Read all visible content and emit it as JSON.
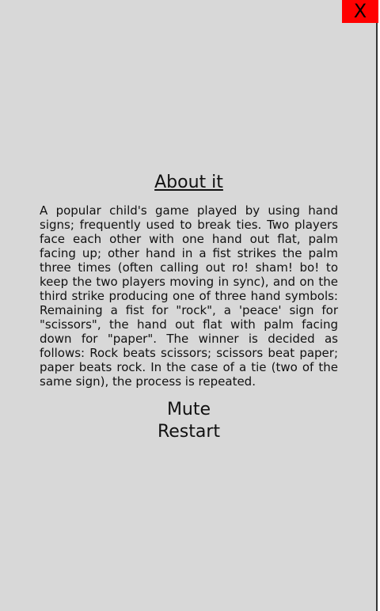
{
  "close_button": {
    "label": "X"
  },
  "about": {
    "title": "About it",
    "text": "A popular child's game played by using hand signs; frequently used to break ties. Two players face each other with one hand out flat, palm facing up; other hand in a fist strikes the palm three times (often calling out ro! sham! bo! to keep the two players moving in sync), and on the third strike producing one of three hand symbols: Remaining a fist for \"rock\", a 'peace' sign for \"scissors\", the hand out flat with palm facing down for \"paper\". The winner is decided as follows: Rock beats scissors; scissors beat paper; paper beats rock. In the case of a tie (two of the same sign), the process is repeated."
  },
  "menu": {
    "mute_label": "Mute",
    "restart_label": "Restart"
  },
  "colors": {
    "panel_background": "#d8d8d8",
    "close_button_background": "#ff0000"
  }
}
